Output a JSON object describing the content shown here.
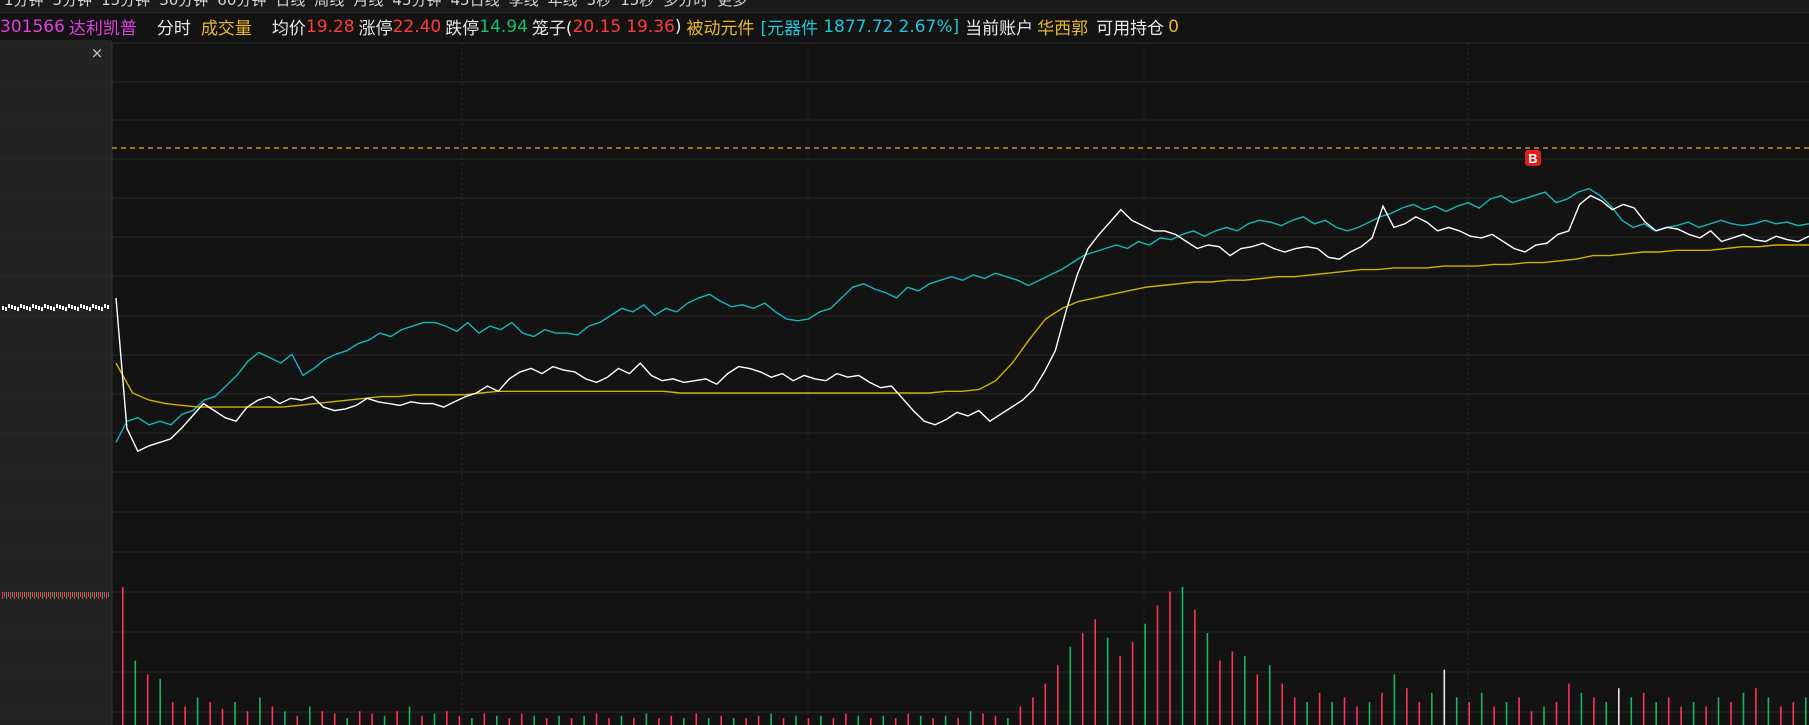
{
  "top_tabs": [
    "1分钟",
    "5分钟",
    "15分钟",
    "30分钟",
    "60分钟",
    "日线",
    "周线",
    "月线",
    "45分钟",
    "45日线",
    "季线",
    "年线",
    "5秒",
    "15秒",
    "多分时",
    "更多"
  ],
  "stock": {
    "code": "301566",
    "name": "达利凯普"
  },
  "info": {
    "timeshare_label": "分时",
    "volume_label": "成交量",
    "avg_label": "均价",
    "avg_value": "19.28",
    "limit_up_label": "涨停",
    "limit_up_value": "22.40",
    "limit_down_label": "跌停",
    "limit_down_value": "14.94",
    "cage_label": "笼子(",
    "cage_low": "20.15",
    "cage_high": "19.36",
    "cage_close": ")",
    "sector_label": "被动元件",
    "index_open": "[元器件",
    "index_value": "1877.72",
    "index_change": "2.67%]",
    "account_label": "当前账户",
    "account_name": "华西郭",
    "position_label": "可用持仓",
    "position_value": "0"
  },
  "marker_label": "B",
  "colors": {
    "price": "#ffffff",
    "avg": "#d4b000",
    "index": "#18b4bc",
    "up": "#ff3355",
    "down": "#16b85c",
    "ref": "#ff9a2a",
    "grid": "#2c2c2c",
    "panel_bg": "#222222"
  },
  "chart_data": {
    "type": "line",
    "series": [
      {
        "values": [
          0.92,
          0.18,
          0.05,
          0.08,
          0.1,
          0.12,
          0.18,
          0.25,
          0.32,
          0.28,
          0.24,
          0.22,
          0.3,
          0.34,
          0.36,
          0.32,
          0.35,
          0.34,
          0.36,
          0.3,
          0.28,
          0.29,
          0.31,
          0.35,
          0.33,
          0.32,
          0.31,
          0.33,
          0.32,
          0.32,
          0.3,
          0.33,
          0.36,
          0.38,
          0.42,
          0.39,
          0.46,
          0.5,
          0.52,
          0.49,
          0.53,
          0.51,
          0.5,
          0.46,
          0.44,
          0.47,
          0.52,
          0.49,
          0.55,
          0.48,
          0.45,
          0.46,
          0.44,
          0.45,
          0.46,
          0.43,
          0.49,
          0.53,
          0.52,
          0.5,
          0.47,
          0.49,
          0.45,
          0.48,
          0.46,
          0.45,
          0.49,
          0.47,
          0.48,
          0.44,
          0.41,
          0.42,
          0.35,
          0.28,
          0.22,
          0.2,
          0.23,
          0.27,
          0.25,
          0.28,
          0.22,
          0.26,
          0.3,
          0.34,
          0.4,
          0.5,
          0.62,
          0.85,
          1.05,
          1.2,
          1.28,
          1.35,
          1.42,
          1.36,
          1.33,
          1.3,
          1.3,
          1.28,
          1.24,
          1.2,
          1.22,
          1.21,
          1.16,
          1.2,
          1.21,
          1.23,
          1.2,
          1.18,
          1.2,
          1.21,
          1.2,
          1.15,
          1.14,
          1.18,
          1.21,
          1.26,
          1.44,
          1.32,
          1.34,
          1.38,
          1.35,
          1.3,
          1.32,
          1.3,
          1.27,
          1.26,
          1.28,
          1.24,
          1.2,
          1.18,
          1.22,
          1.23,
          1.28,
          1.3,
          1.45,
          1.5,
          1.47,
          1.42,
          1.45,
          1.43,
          1.35,
          1.3,
          1.32,
          1.31,
          1.28,
          1.26,
          1.3,
          1.24,
          1.26,
          1.28,
          1.25,
          1.24,
          1.27,
          1.25,
          1.24,
          1.27
        ]
      },
      {
        "values": [
          0.55,
          0.38,
          0.34,
          0.32,
          0.31,
          0.3,
          0.3,
          0.3,
          0.3,
          0.3,
          0.3,
          0.31,
          0.32,
          0.33,
          0.34,
          0.35,
          0.36,
          0.36,
          0.37,
          0.37,
          0.37,
          0.37,
          0.38,
          0.39,
          0.39,
          0.39,
          0.39,
          0.39,
          0.39,
          0.39,
          0.39,
          0.39,
          0.39,
          0.39,
          0.38,
          0.38,
          0.38,
          0.38,
          0.38,
          0.38,
          0.38,
          0.38,
          0.38,
          0.38,
          0.38,
          0.38,
          0.38,
          0.38,
          0.38,
          0.38,
          0.39,
          0.39,
          0.4,
          0.45,
          0.55,
          0.68,
          0.8,
          0.86,
          0.9,
          0.92,
          0.94,
          0.96,
          0.98,
          0.99,
          1.0,
          1.01,
          1.01,
          1.02,
          1.02,
          1.03,
          1.04,
          1.04,
          1.05,
          1.06,
          1.07,
          1.08,
          1.08,
          1.09,
          1.09,
          1.09,
          1.1,
          1.1,
          1.1,
          1.11,
          1.11,
          1.12,
          1.12,
          1.13,
          1.14,
          1.16,
          1.16,
          1.17,
          1.18,
          1.18,
          1.19,
          1.19,
          1.19,
          1.2,
          1.21,
          1.21,
          1.22,
          1.22,
          1.22
        ]
      },
      {
        "values": [
          0.1,
          0.22,
          0.24,
          0.2,
          0.22,
          0.2,
          0.26,
          0.28,
          0.34,
          0.36,
          0.42,
          0.48,
          0.56,
          0.61,
          0.58,
          0.55,
          0.6,
          0.48,
          0.52,
          0.57,
          0.6,
          0.62,
          0.66,
          0.68,
          0.72,
          0.7,
          0.74,
          0.76,
          0.78,
          0.78,
          0.76,
          0.73,
          0.78,
          0.72,
          0.76,
          0.74,
          0.78,
          0.72,
          0.7,
          0.74,
          0.72,
          0.72,
          0.71,
          0.76,
          0.78,
          0.82,
          0.86,
          0.84,
          0.88,
          0.82,
          0.86,
          0.84,
          0.89,
          0.92,
          0.94,
          0.9,
          0.87,
          0.88,
          0.86,
          0.89,
          0.84,
          0.8,
          0.79,
          0.8,
          0.84,
          0.86,
          0.92,
          0.98,
          1.0,
          0.97,
          0.95,
          0.92,
          0.98,
          0.96,
          1.0,
          1.02,
          1.04,
          1.02,
          1.05,
          1.03,
          1.06,
          1.04,
          1.02,
          0.99,
          1.02,
          1.05,
          1.08,
          1.12,
          1.16,
          1.18,
          1.2,
          1.22,
          1.2,
          1.24,
          1.22,
          1.26,
          1.25,
          1.28,
          1.3,
          1.27,
          1.3,
          1.32,
          1.3,
          1.34,
          1.36,
          1.35,
          1.33,
          1.36,
          1.38,
          1.34,
          1.36,
          1.32,
          1.3,
          1.32,
          1.35,
          1.38,
          1.4,
          1.43,
          1.45,
          1.42,
          1.44,
          1.41,
          1.44,
          1.46,
          1.43,
          1.48,
          1.5,
          1.46,
          1.48,
          1.5,
          1.52,
          1.46,
          1.48,
          1.52,
          1.54,
          1.5,
          1.44,
          1.36,
          1.32,
          1.34,
          1.3,
          1.32,
          1.33,
          1.35,
          1.32,
          1.34,
          1.36,
          1.34,
          1.33,
          1.34,
          1.36,
          1.34,
          1.35,
          1.33,
          1.34
        ]
      }
    ],
    "volume": {
      "values": [
        60,
        28,
        22,
        20,
        10,
        8,
        12,
        10,
        7,
        10,
        6,
        12,
        8,
        6,
        4,
        8,
        6,
        5,
        3,
        6,
        5,
        4,
        6,
        8,
        4,
        5,
        6,
        4,
        3,
        5,
        4,
        3,
        5,
        4,
        3,
        4,
        3,
        4,
        5,
        3,
        4,
        3,
        5,
        3,
        4,
        3,
        5,
        3,
        4,
        3,
        3,
        4,
        5,
        3,
        4,
        3,
        4,
        3,
        5,
        4,
        3,
        4,
        3,
        5,
        4,
        3,
        4,
        3,
        6,
        5,
        4,
        3,
        8,
        12,
        18,
        26,
        34,
        40,
        46,
        38,
        30,
        36,
        44,
        52,
        58,
        60,
        50,
        40,
        28,
        32,
        30,
        22,
        26,
        18,
        12,
        10,
        14,
        10,
        12,
        8,
        10,
        14,
        22,
        16,
        10,
        14,
        24,
        12,
        10,
        14,
        8,
        10,
        12,
        6,
        8,
        10,
        18,
        14,
        12,
        10,
        16,
        12,
        14,
        10,
        12,
        8,
        10,
        8,
        12,
        10,
        14,
        16,
        12,
        8,
        10,
        12
      ],
      "colors": [
        "u",
        "d",
        "u",
        "d",
        "u",
        "u",
        "d",
        "u",
        "u",
        "d",
        "u",
        "d",
        "u",
        "d",
        "u",
        "d",
        "u",
        "u",
        "d",
        "u",
        "u",
        "d",
        "u",
        "d",
        "u",
        "d",
        "u",
        "u",
        "d",
        "u",
        "d",
        "u",
        "u",
        "d",
        "u",
        "d",
        "u",
        "d",
        "u",
        "u",
        "d",
        "u",
        "d",
        "u",
        "u",
        "d",
        "u",
        "d",
        "u",
        "d",
        "u",
        "u",
        "d",
        "u",
        "d",
        "u",
        "d",
        "u",
        "u",
        "d",
        "u",
        "d",
        "u",
        "u",
        "d",
        "u",
        "d",
        "u",
        "d",
        "u",
        "u",
        "d",
        "u",
        "u",
        "u",
        "u",
        "d",
        "u",
        "u",
        "d",
        "u",
        "u",
        "d",
        "u",
        "u",
        "d",
        "u",
        "d",
        "u",
        "u",
        "d",
        "u",
        "d",
        "u",
        "u",
        "d",
        "u",
        "d",
        "u",
        "u",
        "d",
        "u",
        "d",
        "u",
        "u",
        "d",
        "w",
        "d",
        "u",
        "d",
        "u",
        "d",
        "u",
        "u",
        "d",
        "u",
        "u",
        "d",
        "u",
        "d",
        "w",
        "d",
        "u",
        "d",
        "u",
        "u",
        "d",
        "u",
        "d",
        "u",
        "d",
        "u",
        "d",
        "u",
        "u",
        "d"
      ]
    }
  }
}
